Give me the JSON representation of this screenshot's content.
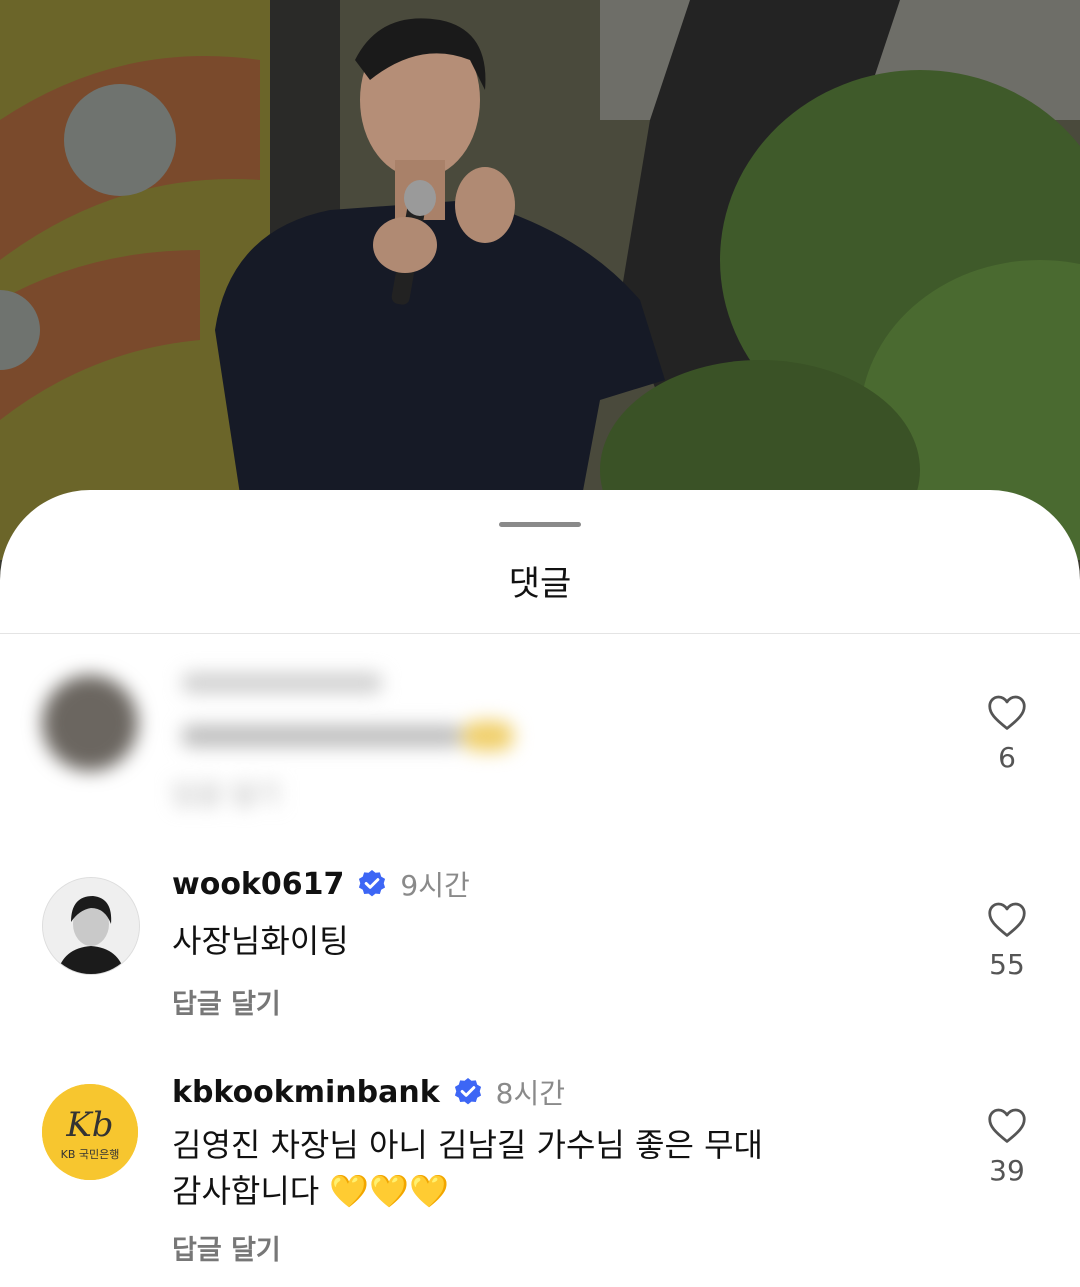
{
  "sheet": {
    "title": "댓글"
  },
  "comments": [
    {
      "username": "",
      "time": "",
      "text": "",
      "reply_label": "답글 달기",
      "like_count": "6",
      "hidden": true
    },
    {
      "username": "wook0617",
      "verified": true,
      "time": "9시간",
      "text": "사장님화이팅",
      "reply_label": "답글 달기",
      "like_count": "55"
    },
    {
      "username": "kbkookminbank",
      "verified": true,
      "time": "8시간",
      "text_line1": "김영진 차장님 아니 김남길 가수님 좋은 무대",
      "text_line2": "감사합니다",
      "emoji": "💛💛💛",
      "reply_label": "답글 달기",
      "like_count": "39",
      "avatar_logo": {
        "mark": "Kb",
        "text": "KB 국민은행"
      }
    }
  ],
  "colors": {
    "verified": "#3d66f5",
    "kb_yellow": "#f7c62f"
  }
}
